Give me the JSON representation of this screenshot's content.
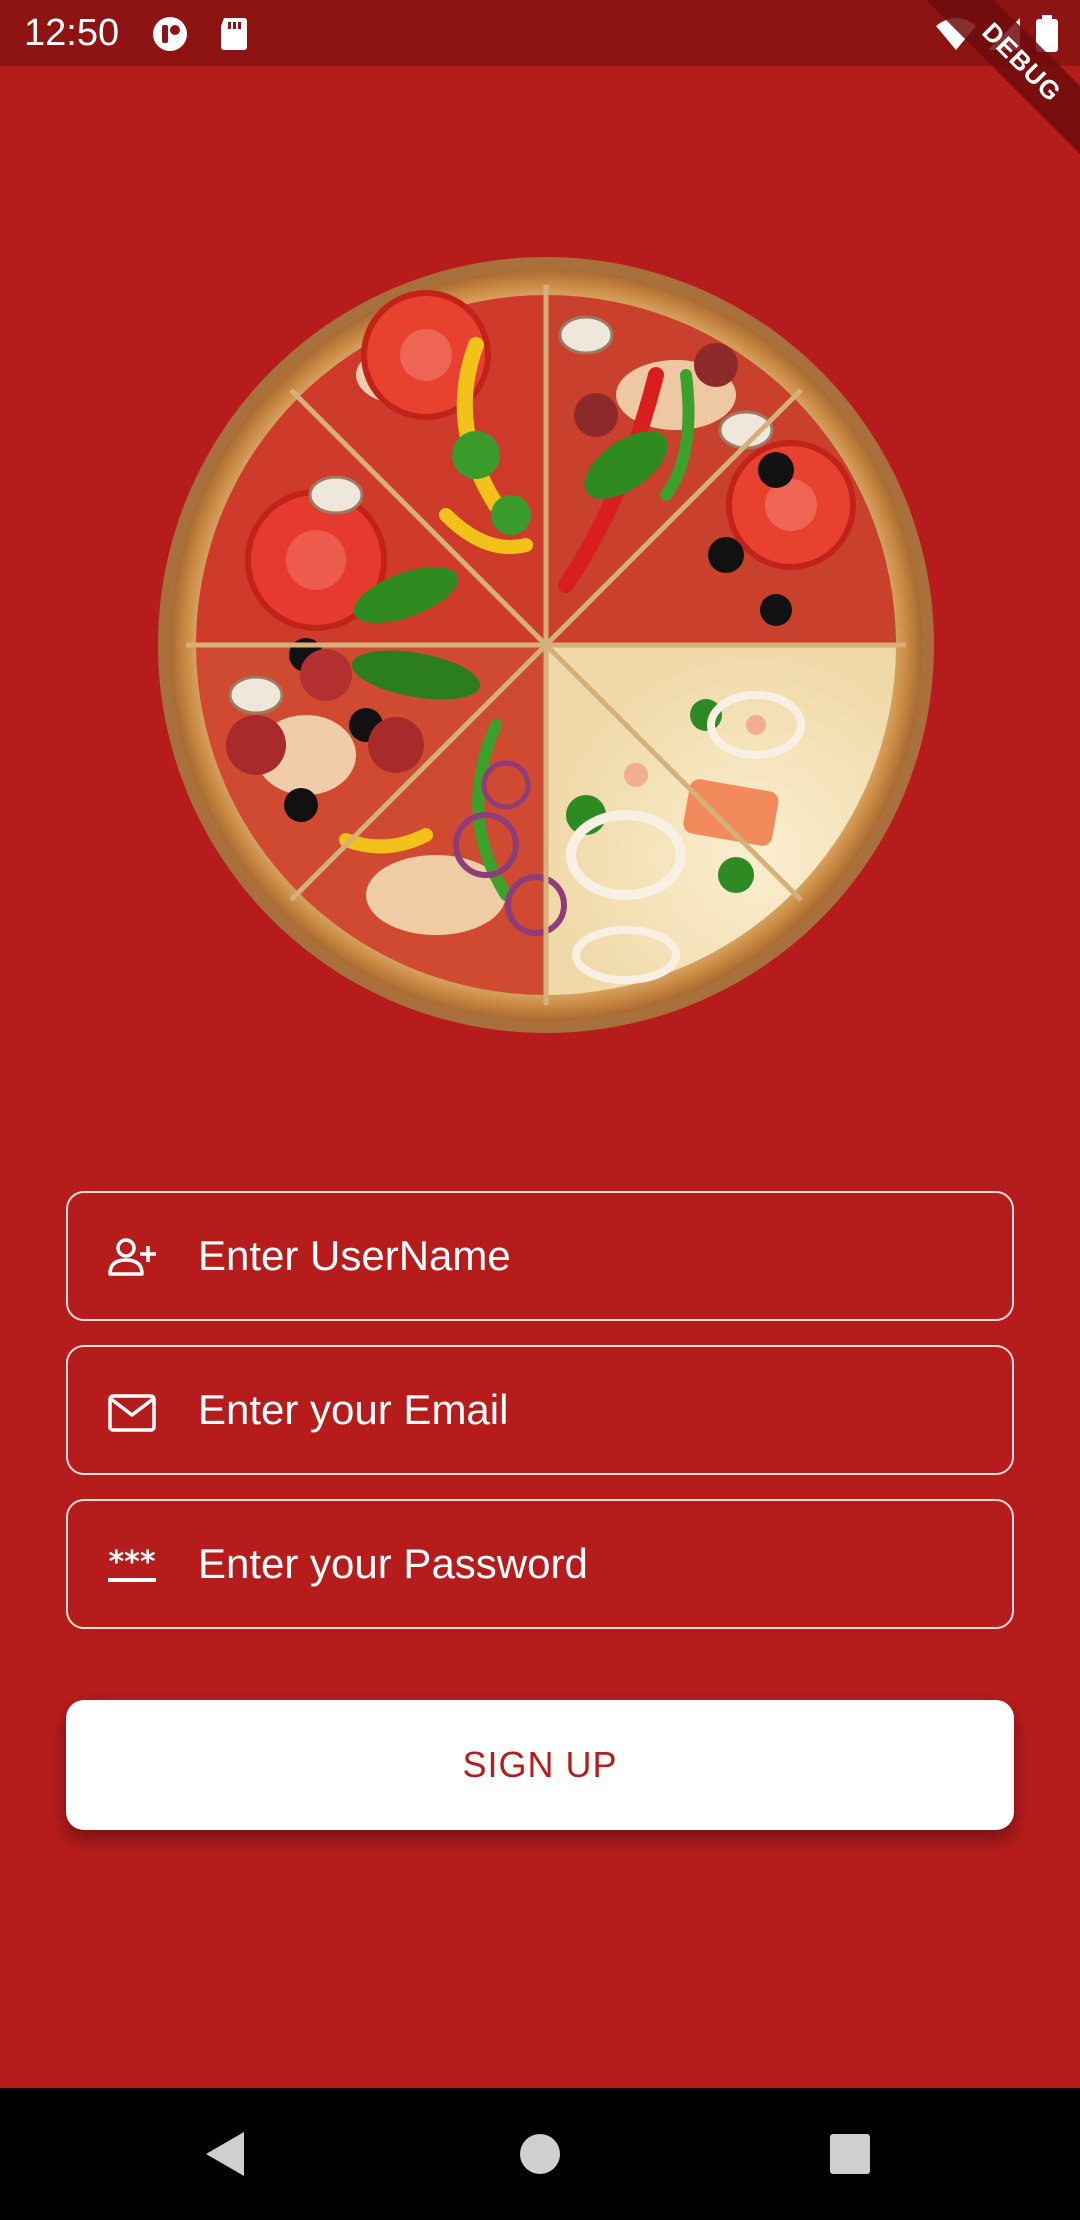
{
  "status_bar": {
    "time": "12:50",
    "icons": [
      "app-notification-icon",
      "sd-card-icon",
      "wifi-icon",
      "signal-icon",
      "battery-icon"
    ],
    "debug_label": "DEBUG"
  },
  "hero": {
    "image": "pizza-illustration"
  },
  "form": {
    "username": {
      "placeholder": "Enter UserName",
      "value": "",
      "icon": "person-add-icon"
    },
    "email": {
      "placeholder": "Enter your Email",
      "value": "",
      "icon": "mail-icon"
    },
    "password": {
      "placeholder": "Enter your Password",
      "value": "",
      "icon": "password-icon"
    },
    "submit_label": "SIGN UP"
  },
  "nav_bar": {
    "buttons": [
      "back-icon",
      "home-icon",
      "recents-icon"
    ]
  },
  "colors": {
    "background": "#b71c1c",
    "status_bar": "#8e1414",
    "button_bg": "#ffffff",
    "button_text": "#b71c1c"
  }
}
